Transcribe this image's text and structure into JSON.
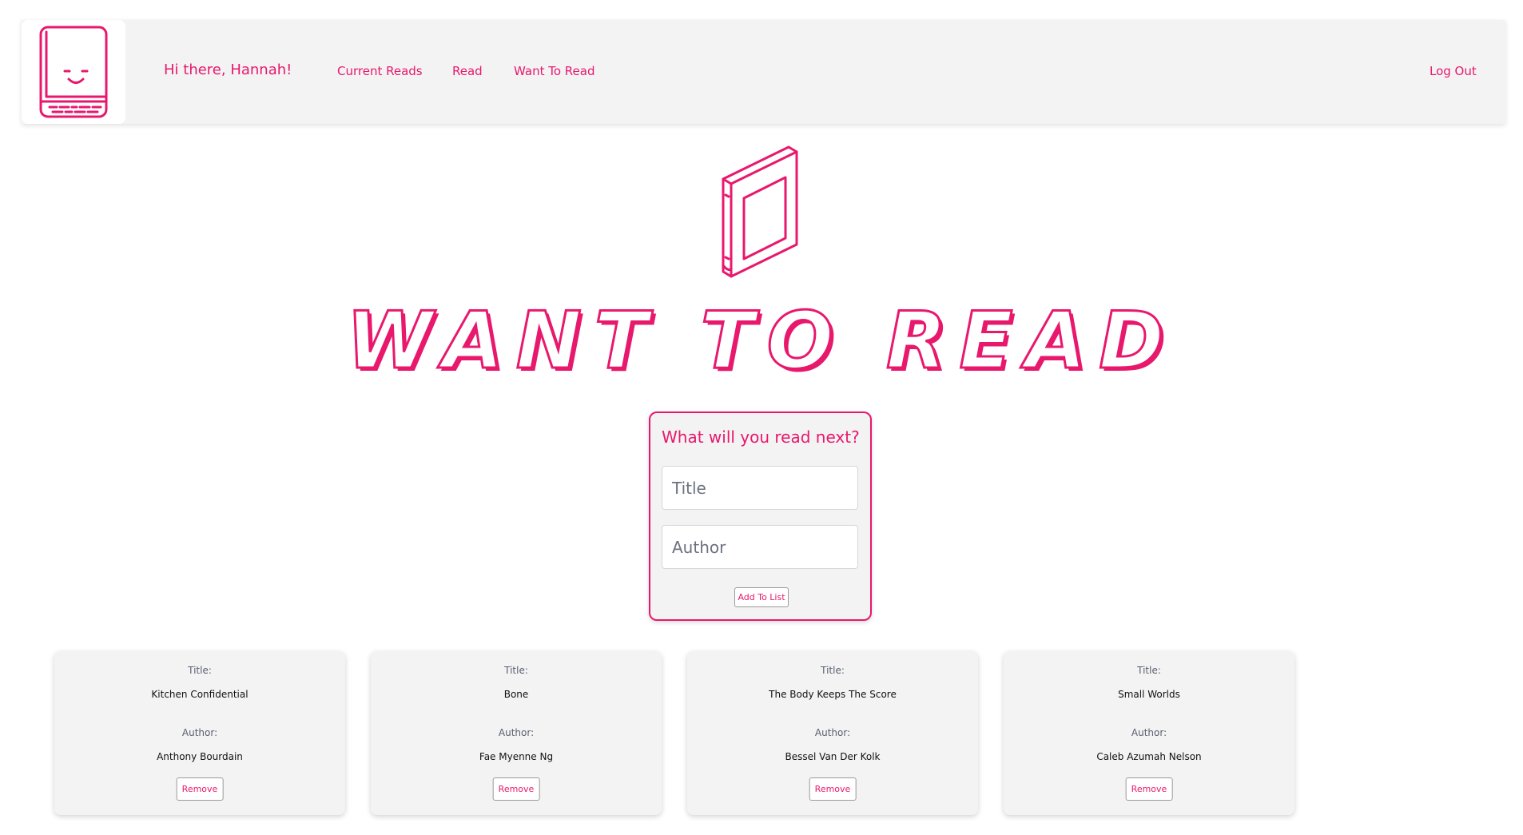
{
  "colors": {
    "accent": "#e8186d",
    "panel": "#f3f3f3",
    "background": "#ffffff"
  },
  "nav": {
    "greeting": "Hi there, Hannah!",
    "links": [
      "Current Reads",
      "Read",
      "Want To Read"
    ],
    "logout": "Log Out",
    "logo_icon": "smiling-book-icon"
  },
  "hero": {
    "icon": "book-icon",
    "title": "WANT TO READ"
  },
  "form": {
    "heading": "What will you read next?",
    "title_placeholder": "Title",
    "author_placeholder": "Author",
    "submit_label": "Add To List"
  },
  "books": [
    {
      "title_label": "Title:",
      "title": "Kitchen Confidential",
      "author_label": "Author:",
      "author": "Anthony Bourdain",
      "remove_label": "Remove"
    },
    {
      "title_label": "Title:",
      "title": "Bone",
      "author_label": "Author:",
      "author": "Fae Myenne Ng",
      "remove_label": "Remove"
    },
    {
      "title_label": "Title:",
      "title": "The Body Keeps The Score",
      "author_label": "Author:",
      "author": "Bessel Van Der Kolk",
      "remove_label": "Remove"
    },
    {
      "title_label": "Title:",
      "title": "Small Worlds",
      "author_label": "Author:",
      "author": "Caleb Azumah Nelson",
      "remove_label": "Remove"
    }
  ]
}
